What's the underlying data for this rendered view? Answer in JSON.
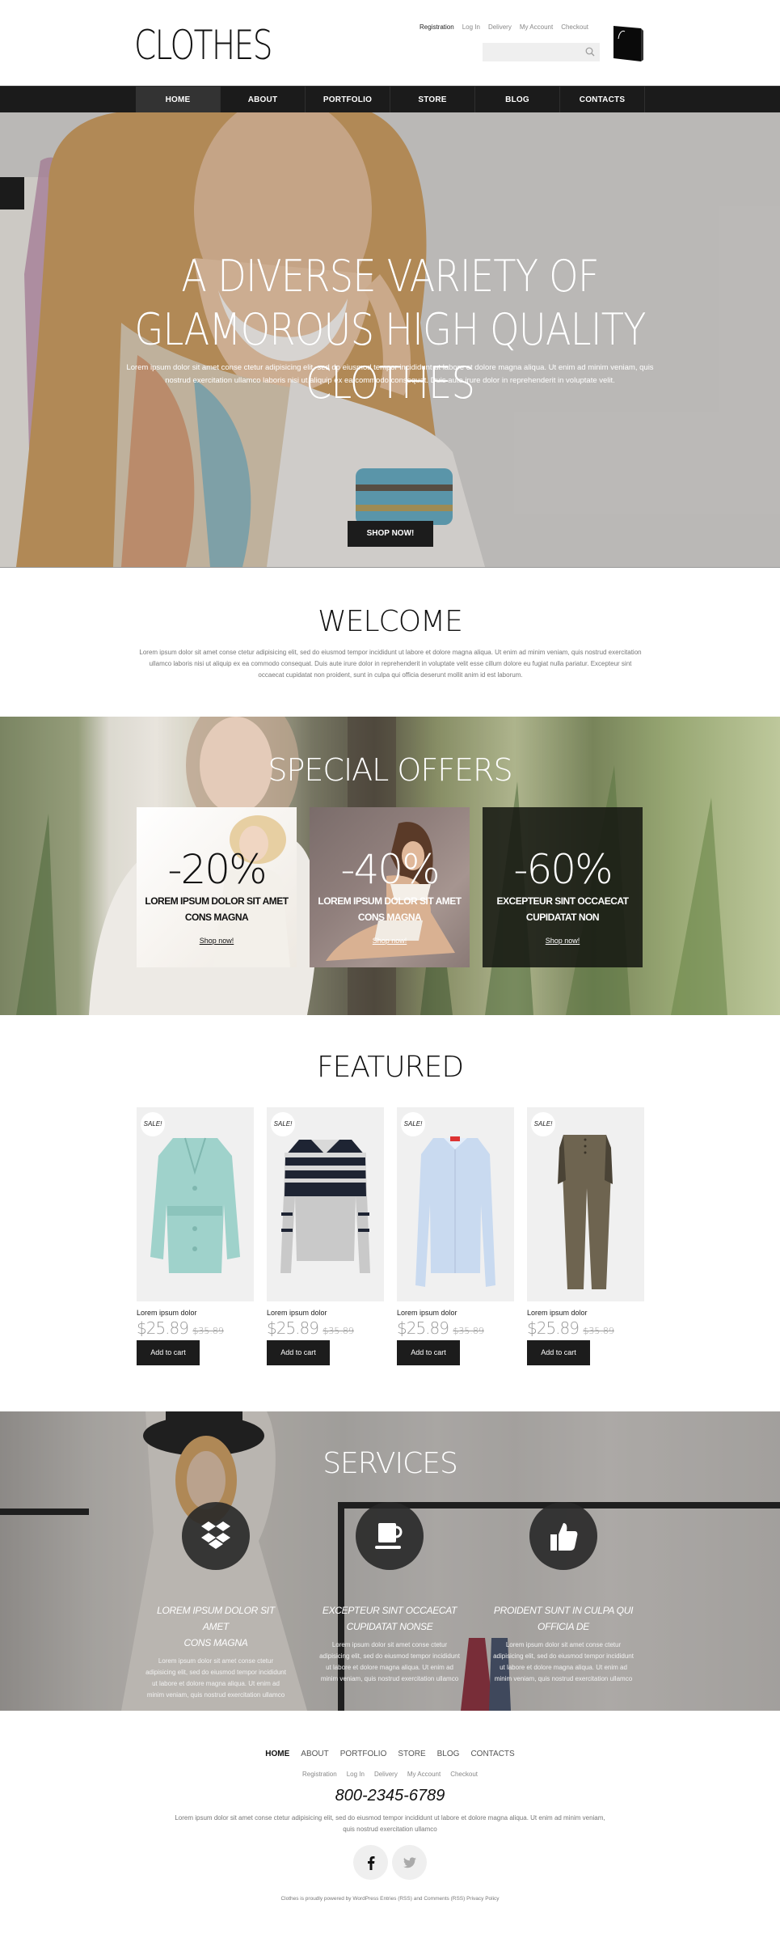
{
  "header": {
    "logo": "CLOTHES",
    "top_links": [
      "Registration",
      "Log In",
      "Delivery",
      "My Account",
      "Checkout"
    ],
    "search": {
      "value": "",
      "placeholder": ""
    },
    "icons": {
      "search": "search-icon",
      "cart": "shopping-bag-icon"
    }
  },
  "nav": {
    "items": [
      "HOME",
      "ABOUT",
      "PORTFOLIO",
      "STORE",
      "BLOG",
      "CONTACTS"
    ],
    "active": "HOME"
  },
  "hero": {
    "title_line1": "A DIVERSE VARIETY OF",
    "title_line2": "GLAMOROUS HIGH QUALITY CLOTHES",
    "text": "Lorem ipsum dolor sit amet conse ctetur adipisicing elit, sed do eiusmod tempor incididunt ut labore et dolore magna aliqua. Ut enim ad minim veniam, quis nostrud exercitation ullamco laboris nisi ut aliquip ex ea commodo consequat. Duis aute irure dolor in reprehenderit in voluptate velit.",
    "button": "SHOP NOW!"
  },
  "welcome": {
    "title": "WELCOME",
    "text": "Lorem ipsum dolor sit amet conse ctetur adipisicing elit, sed do eiusmod tempor incididunt ut labore et dolore magna aliqua. Ut enim ad minim veniam, quis nostrud exercitation ullamco laboris nisi ut aliquip ex ea commodo consequat. Duis aute irure dolor in reprehenderit in voluptate velit esse cillum dolore eu fugiat nulla pariatur. Excepteur sint occaecat cupidatat non proident, sunt in culpa qui officia deserunt mollit anim id est laborum."
  },
  "offers": {
    "title": "SPECIAL OFFERS",
    "cards": [
      {
        "discount": "-20%",
        "desc_line1": "LOREM IPSUM DOLOR SIT AMET",
        "desc_line2": "CONS MAGNA",
        "link": "Shop now!"
      },
      {
        "discount": "-40%",
        "desc_line1": "LOREM IPSUM DOLOR SIT AMET",
        "desc_line2": "CONS MAGNA",
        "link": "Shop now!"
      },
      {
        "discount": "-60%",
        "desc_line1": "EXCEPTEUR SINT OCCAECAT",
        "desc_line2": "CUPIDATAT NON",
        "link": "Shop now!"
      }
    ]
  },
  "featured": {
    "title": "FEATURED",
    "products": [
      {
        "badge": "SALE!",
        "name": "Lorem ipsum dolor",
        "price": "$25.89",
        "old_price": "$35.89",
        "button": "Add to cart",
        "image": "mint-trench-coat",
        "color": "#9fd2cb"
      },
      {
        "badge": "SALE!",
        "name": "Lorem ipsum dolor",
        "price": "$25.89",
        "old_price": "$35.89",
        "button": "Add to cart",
        "image": "striped-sweater",
        "color": "#1e2433"
      },
      {
        "badge": "SALE!",
        "name": "Lorem ipsum dolor",
        "price": "$25.89",
        "old_price": "$35.89",
        "button": "Add to cart",
        "image": "light-blue-shirt",
        "color": "#c9daf0"
      },
      {
        "badge": "SALE!",
        "name": "Lorem ipsum dolor",
        "price": "$25.89",
        "old_price": "$35.89",
        "button": "Add to cart",
        "image": "olive-trousers",
        "color": "#6e6450"
      }
    ]
  },
  "services": {
    "title": "SERVICES",
    "items": [
      {
        "icon": "dropbox-icon",
        "title_line1": "LOREM IPSUM DOLOR SIT AMET",
        "title_line2": "CONS MAGNA",
        "text": "Lorem ipsum dolor sit amet conse ctetur adipisicing elit, sed do eiusmod tempor incididunt ut labore et dolore magna aliqua. Ut enim ad minim veniam, quis nostrud exercitation ullamco"
      },
      {
        "icon": "coffee-cup-icon",
        "title_line1": "EXCEPTEUR SINT OCCAECAT",
        "title_line2": "CUPIDATAT NONSE",
        "text": "Lorem ipsum dolor sit amet conse ctetur adipisicing elit, sed do eiusmod tempor incididunt ut labore et dolore magna aliqua. Ut enim ad minim veniam, quis nostrud exercitation ullamco"
      },
      {
        "icon": "thumbs-up-icon",
        "title_line1": "PROIDENT SUNT IN CULPA QUI",
        "title_line2": "OFFICIA DE",
        "text": "Lorem ipsum dolor sit amet conse ctetur adipisicing elit, sed do eiusmod tempor incididunt ut labore et dolore magna aliqua. Ut enim ad minim veniam, quis nostrud exercitation ullamco"
      }
    ]
  },
  "footer": {
    "nav": [
      "HOME",
      "ABOUT",
      "PORTFOLIO",
      "STORE",
      "BLOG",
      "CONTACTS"
    ],
    "links": [
      "Registration",
      "Log In",
      "Delivery",
      "My Account",
      "Checkout"
    ],
    "phone": "800-2345-6789",
    "text": "Lorem ipsum dolor sit amet conse ctetur adipisicing elit, sed do eiusmod tempor incididunt ut labore et dolore magna aliqua. Ut enim ad minim veniam, quis nostrud exercitation ullamco",
    "socials": [
      {
        "icon": "facebook-icon",
        "label": "f",
        "color": "#111111"
      },
      {
        "icon": "twitter-icon",
        "label": "t",
        "color": "#aaaaaa"
      }
    ],
    "copyright": "Clothes is proudly powered by WordPress Entries (RSS) and Comments (RSS) Privacy Policy"
  },
  "colors": {
    "dark": "#1c1c1c",
    "nav_bg": "#1b1b1b",
    "nav_active": "#333333",
    "price_grey": "#999999",
    "card_bg": "#f0f0f0"
  }
}
